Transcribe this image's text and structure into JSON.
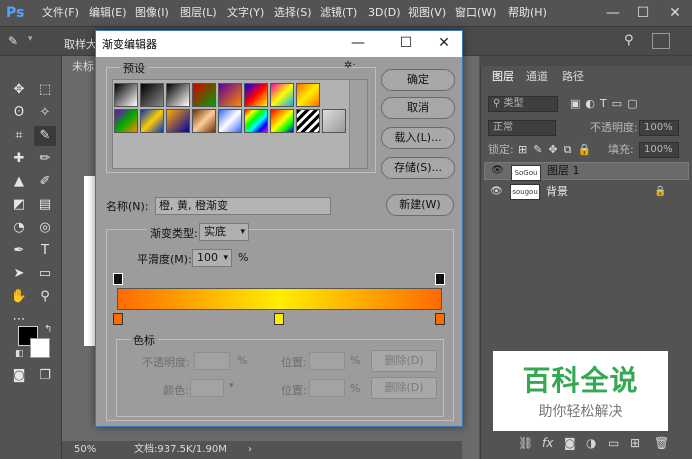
{
  "app": {
    "logo": "Ps"
  },
  "menu": [
    "文件(F)",
    "编辑(E)",
    "图像(I)",
    "图层(L)",
    "文字(Y)",
    "选择(S)",
    "滤镜(T)",
    "3D(D)",
    "视图(V)",
    "窗口(W)",
    "帮助(H)"
  ],
  "window_controls": {
    "minimize": "—",
    "maximize": "☐",
    "close": "✕"
  },
  "options": {
    "sample_label": "取样大"
  },
  "document": {
    "tab_label": "未标",
    "zoom": "50%",
    "doc_info": "文档:937.5K/1.90M"
  },
  "layers_panel": {
    "tabs": [
      "图层",
      "通道",
      "路径"
    ],
    "filter_label": "类型",
    "blend_mode": "正常",
    "opacity_label": "不透明度:",
    "opacity_value": "100%",
    "lock_label": "锁定:",
    "fill_label": "填充:",
    "fill_value": "100%",
    "layers": [
      {
        "name": "图层 1",
        "thumb": "SoGou"
      },
      {
        "name": "背景",
        "thumb": "sougou"
      }
    ]
  },
  "watermark": {
    "title": "百科全说",
    "subtitle": "助你轻松解决"
  },
  "dialog": {
    "title": "渐变编辑器",
    "presets_label": "预设",
    "buttons": {
      "ok": "确定",
      "cancel": "取消",
      "load": "载入(L)...",
      "save": "存储(S)...",
      "new": "新建(W)"
    },
    "name_label": "名称(N):",
    "name_value": "橙, 黄, 橙渐变",
    "gradient_type_label": "渐变类型:",
    "gradient_type_value": "实底",
    "smoothness_label": "平滑度(M):",
    "smoothness_value": "100",
    "smoothness_unit": "%",
    "stops_label": "色标",
    "opacity_label": "不透明度:",
    "location_label": "位置:",
    "percent": "%",
    "delete_label": "删除(D)",
    "color_label": "颜色:",
    "gradient_colors": [
      "#ff6a00",
      "#ffee00",
      "#ff6a00"
    ]
  }
}
